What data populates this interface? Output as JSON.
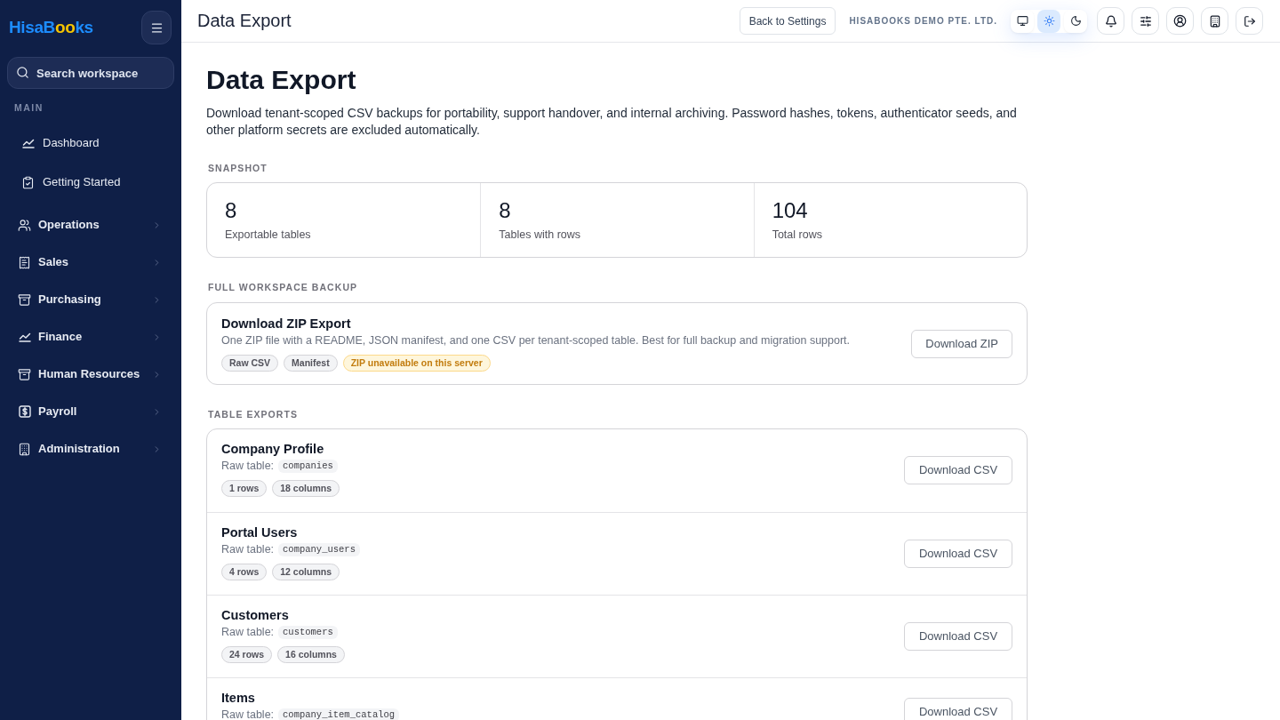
{
  "sidebar": {
    "logo": [
      "HisaB",
      "oo",
      "ks"
    ],
    "search": {
      "placeholder": "Search workspace"
    },
    "section_label": "MAIN",
    "main_items": [
      {
        "label": "Dashboard"
      },
      {
        "label": "Getting Started"
      }
    ],
    "groups": [
      {
        "label": "Operations",
        "expanded": false
      },
      {
        "label": "Sales",
        "expanded": false
      },
      {
        "label": "Purchasing",
        "expanded": false
      },
      {
        "label": "Finance",
        "expanded": false
      },
      {
        "label": "Human Resources",
        "expanded": false
      },
      {
        "label": "Payroll",
        "expanded": false
      },
      {
        "label": "Administration",
        "expanded": false
      }
    ]
  },
  "header": {
    "title": "Data Export",
    "back_button": "Back to Settings",
    "company": "HISABOOKS DEMO PTE. LTD.",
    "theme_modes": [
      {
        "kind": "system",
        "selected": false
      },
      {
        "kind": "light",
        "selected": true
      },
      {
        "kind": "dark",
        "selected": false
      }
    ]
  },
  "page": {
    "title": "Data Export",
    "description": "Download tenant-scoped CSV backups for portability, support handover, and internal archiving. Password hashes, tokens, authenticator seeds, and other platform secrets are excluded automatically.",
    "snapshot": {
      "label": "SNAPSHOT",
      "stats": [
        {
          "value": "8",
          "label": "Exportable tables"
        },
        {
          "value": "8",
          "label": "Tables with rows"
        },
        {
          "value": "104",
          "label": "Total rows"
        }
      ]
    },
    "full_backup": {
      "label": "FULL WORKSPACE BACKUP",
      "title": "Download ZIP Export",
      "description": "One ZIP file with a README, JSON manifest, and one CSV per tenant-scoped table. Best for full backup and migration support.",
      "tags": [
        {
          "label": "Raw CSV",
          "kind": "neutral"
        },
        {
          "label": "Manifest",
          "kind": "neutral"
        },
        {
          "label": "ZIP unavailable on this server",
          "kind": "warning"
        }
      ],
      "button": "Download ZIP"
    },
    "table_exports": {
      "label": "TABLE EXPORTS",
      "rows": [
        {
          "name": "Company Profile",
          "raw_label": "Raw table:",
          "table": "companies",
          "tags": [
            "1 rows",
            "18 columns"
          ],
          "button": "Download CSV"
        },
        {
          "name": "Portal Users",
          "raw_label": "Raw table:",
          "table": "company_users",
          "tags": [
            "4 rows",
            "12 columns"
          ],
          "button": "Download CSV"
        },
        {
          "name": "Customers",
          "raw_label": "Raw table:",
          "table": "customers",
          "tags": [
            "24 rows",
            "16 columns"
          ],
          "button": "Download CSV"
        },
        {
          "name": "Items",
          "raw_label": "Raw table:",
          "table": "company_item_catalog",
          "button": "Download CSV"
        }
      ]
    }
  }
}
